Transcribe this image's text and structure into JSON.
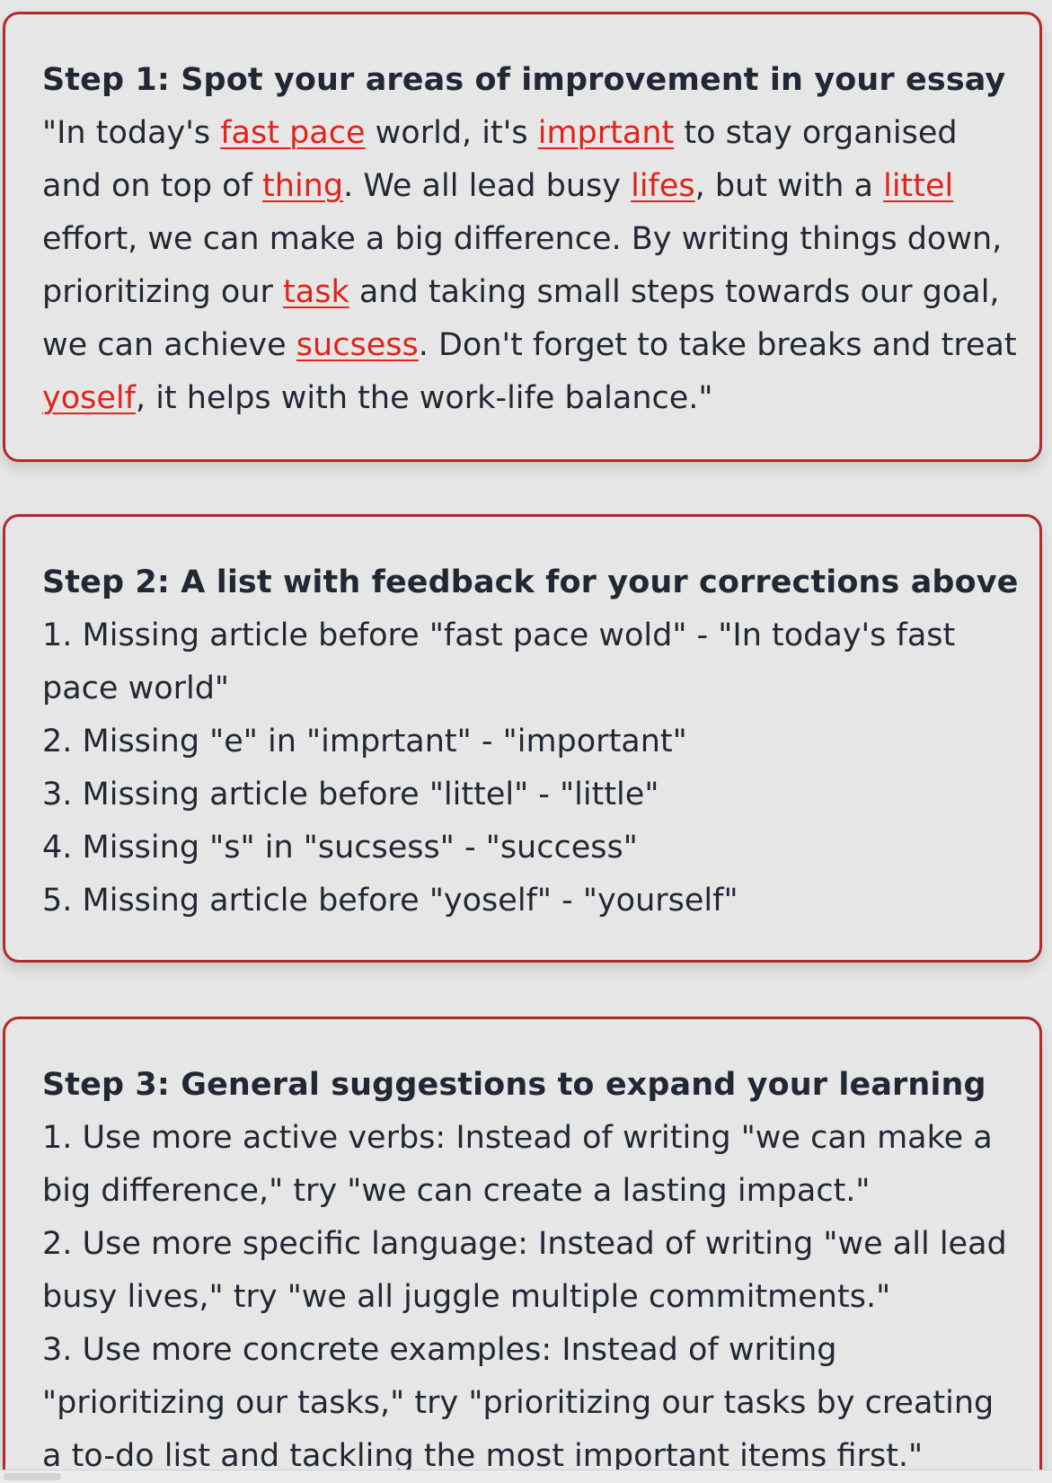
{
  "step1": {
    "title": "Step 1: Spot your areas of improvement in your essay",
    "segments": [
      {
        "text": "\"In today's ",
        "error": false
      },
      {
        "text": "fast pace",
        "error": true
      },
      {
        "text": " world, it's ",
        "error": false
      },
      {
        "text": "imprtant",
        "error": true
      },
      {
        "text": " to stay organised and on top of ",
        "error": false
      },
      {
        "text": "thing",
        "error": true
      },
      {
        "text": ". We all lead busy ",
        "error": false
      },
      {
        "text": "lifes",
        "error": true
      },
      {
        "text": ", but with a ",
        "error": false
      },
      {
        "text": "littel",
        "error": true
      },
      {
        "text": " effort, we can make a big difference. By writing things down, prioritizing our ",
        "error": false
      },
      {
        "text": "task",
        "error": true
      },
      {
        "text": " and taking small steps towards our goal, we can achieve ",
        "error": false
      },
      {
        "text": "sucsess",
        "error": true
      },
      {
        "text": ". Don't forget to take breaks and treat ",
        "error": false
      },
      {
        "text": "yoself",
        "error": true
      },
      {
        "text": ", it helps with the work-life balance.\"",
        "error": false
      }
    ],
    "error_color": "#e0231b"
  },
  "step2": {
    "title": "Step 2: A list with feedback for your corrections above",
    "items": [
      "1. Missing article before \"fast pace wold\" - \"In today's fast pace world\"",
      "2. Missing \"e\" in \"imprtant\" - \"important\"",
      "3. Missing article before \"littel\" - \"little\"",
      "4. Missing \"s\" in \"sucsess\" - \"success\"",
      "5. Missing article before \"yoself\" - \"yourself\""
    ]
  },
  "step3": {
    "title": "Step 3: General suggestions to expand your learning",
    "items": [
      "1. Use more active verbs: Instead of writing \"we can make a big difference,\" try \"we can create a lasting impact.\"",
      "2. Use more specific language: Instead of writing \"we all lead busy lives,\" try \"we all juggle multiple commitments.\"",
      "3. Use more concrete examples: Instead of writing \"prioritizing our tasks,\" try \"prioritizing our tasks by creating a to-do list and tackling the most important items first.\""
    ]
  },
  "colors": {
    "card_border": "#b22a2a",
    "background": "#e6e6e6",
    "text": "#222833"
  }
}
